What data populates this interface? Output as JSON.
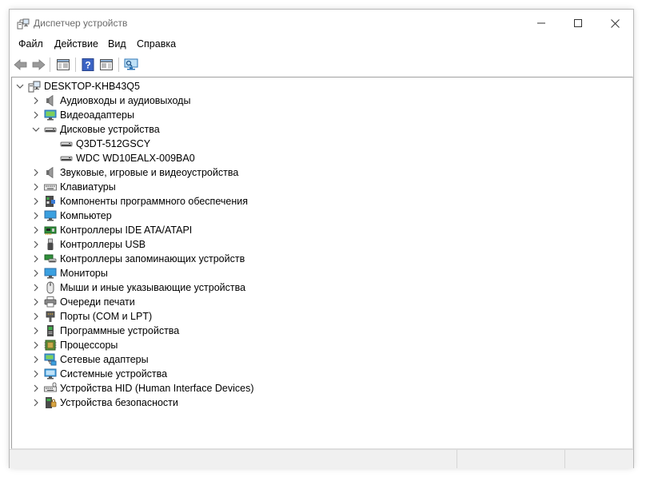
{
  "window": {
    "title": "Диспетчер устройств",
    "controls": {
      "minimize": "minimize",
      "maximize": "maximize",
      "close": "close"
    }
  },
  "menu": [
    {
      "label": "Файл"
    },
    {
      "label": "Действие"
    },
    {
      "label": "Вид"
    },
    {
      "label": "Справка"
    }
  ],
  "toolbar": {
    "buttons": [
      "back-arrow-icon",
      "forward-arrow-icon",
      "properties-pane-icon",
      "help-icon",
      "action-pane-icon",
      "scan-monitor-icon"
    ]
  },
  "tree": {
    "root": {
      "label": "DESKTOP-KHB43Q5",
      "expanded": true,
      "icon": "computer-icon"
    },
    "categories": [
      {
        "label": "Аудиовходы и аудиовыходы",
        "icon": "speaker-icon",
        "expanded": false
      },
      {
        "label": "Видеоадаптеры",
        "icon": "display-adapter-icon",
        "expanded": false
      },
      {
        "label": "Дисковые устройства",
        "icon": "disk-drive-icon",
        "expanded": true,
        "children": [
          {
            "label": "Q3DT-512GSCY",
            "icon": "disk-drive-icon"
          },
          {
            "label": "WDC WD10EALX-009BA0",
            "icon": "disk-drive-icon"
          }
        ]
      },
      {
        "label": "Звуковые, игровые и видеоустройства",
        "icon": "speaker-icon",
        "expanded": false
      },
      {
        "label": "Клавиатуры",
        "icon": "keyboard-icon",
        "expanded": false
      },
      {
        "label": "Компоненты программного обеспечения",
        "icon": "software-component-icon",
        "expanded": false
      },
      {
        "label": "Компьютер",
        "icon": "monitor-icon",
        "expanded": false
      },
      {
        "label": "Контроллеры IDE ATA/ATAPI",
        "icon": "ide-controller-icon",
        "expanded": false
      },
      {
        "label": "Контроллеры USB",
        "icon": "usb-icon",
        "expanded": false
      },
      {
        "label": "Контроллеры запоминающих устройств",
        "icon": "storage-controller-icon",
        "expanded": false
      },
      {
        "label": "Мониторы",
        "icon": "monitor-icon",
        "expanded": false
      },
      {
        "label": "Мыши и иные указывающие устройства",
        "icon": "mouse-icon",
        "expanded": false
      },
      {
        "label": "Очереди печати",
        "icon": "printer-icon",
        "expanded": false
      },
      {
        "label": "Порты (COM и LPT)",
        "icon": "port-icon",
        "expanded": false
      },
      {
        "label": "Программные устройства",
        "icon": "software-device-icon",
        "expanded": false
      },
      {
        "label": "Процессоры",
        "icon": "processor-icon",
        "expanded": false
      },
      {
        "label": "Сетевые адаптеры",
        "icon": "network-adapter-icon",
        "expanded": false
      },
      {
        "label": "Системные устройства",
        "icon": "system-device-icon",
        "expanded": false
      },
      {
        "label": "Устройства HID (Human Interface Devices)",
        "icon": "hid-icon",
        "expanded": false
      },
      {
        "label": "Устройства безопасности",
        "icon": "security-device-icon",
        "expanded": false
      }
    ]
  },
  "colors": {
    "accent_blue": "#1e7fd6",
    "title_text": "#6b6b6b",
    "statusbar_bg": "#f0f0f0"
  }
}
